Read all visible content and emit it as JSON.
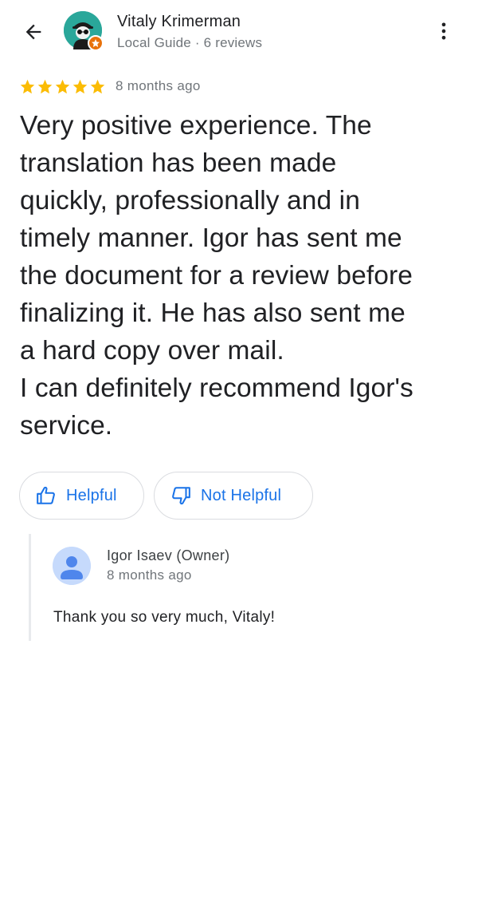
{
  "header": {
    "reviewer_name": "Vitaly Krimerman",
    "reviewer_meta": "Local Guide · 6 reviews",
    "back_icon": "arrow-back-icon",
    "more_icon": "more-vert-icon",
    "avatar_bg_color": "#2aa79a",
    "badge_color": "#e8710a"
  },
  "review": {
    "rating": 5,
    "rating_max": 5,
    "star_color": "#fbbc04",
    "date": "8 months ago",
    "text": "Very positive experience. The\ntranslation has been made\nquickly, professionally and in\ntimely manner. Igor has sent me\nthe document for a review before\nfinalizing it. He has also sent me\na hard copy over mail.\nI can definitely recommend Igor's\nservice."
  },
  "actions": {
    "helpful_label": "Helpful",
    "not_helpful_label": "Not Helpful",
    "accent_color": "#1a73e8"
  },
  "owner_reply": {
    "name": "Igor Isaev (Owner)",
    "date": "8 months ago",
    "text": "Thank you so very much, Vitaly!"
  }
}
